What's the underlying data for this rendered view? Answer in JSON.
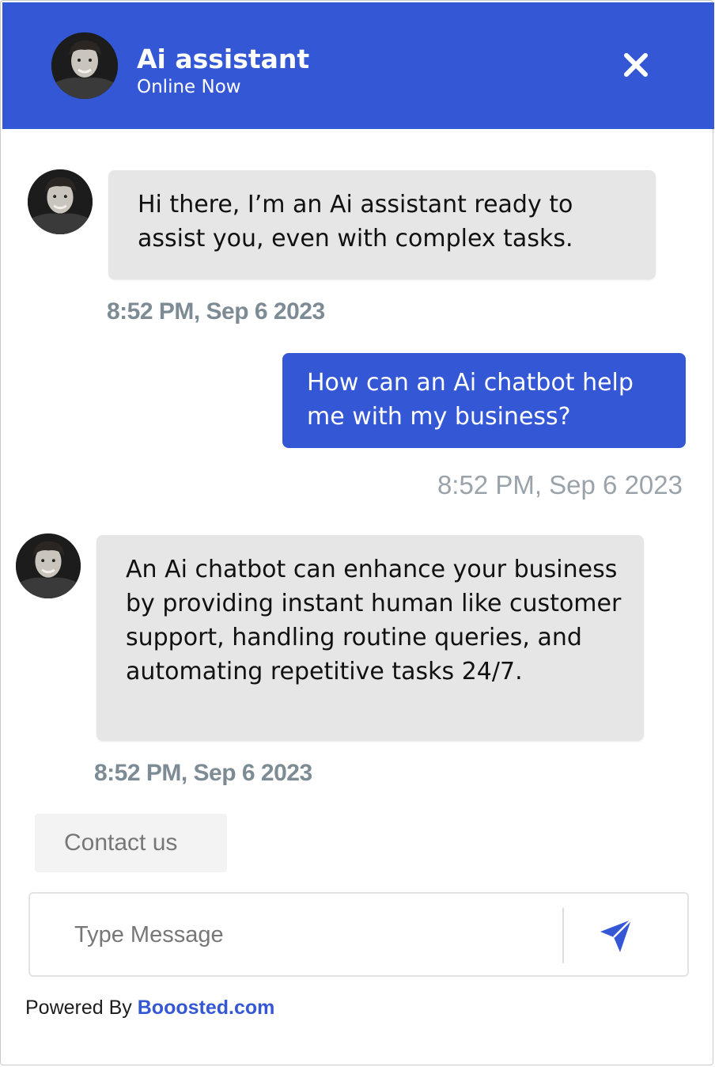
{
  "header": {
    "title": "Ai assistant",
    "status": "Online Now"
  },
  "messages": [
    {
      "sender": "bot",
      "text": "Hi there, I’m an Ai assistant ready to assist you, even with complex tasks.",
      "time": "8:52 PM, Sep 6 2023"
    },
    {
      "sender": "user",
      "text": "How can an Ai chatbot help me with my business?",
      "time": "8:52 PM, Sep 6 2023"
    },
    {
      "sender": "bot",
      "text": "An Ai chatbot can enhance your business by providing instant human like customer support, handling routine queries, and automating repetitive tasks 24/7.",
      "time": "8:52 PM, Sep 6 2023"
    }
  ],
  "quick_reply": {
    "label": "Contact us"
  },
  "composer": {
    "placeholder": "Type Message"
  },
  "footer": {
    "powered_by": "Powered By",
    "brand_link": "Booosted.com"
  },
  "colors": {
    "brand_blue": "#3457d5",
    "bot_bubble": "#e6e6e6",
    "timestamp": "#7d8b94"
  },
  "icons": {
    "close": "close-icon",
    "send": "send-icon",
    "avatar": "avatar"
  }
}
